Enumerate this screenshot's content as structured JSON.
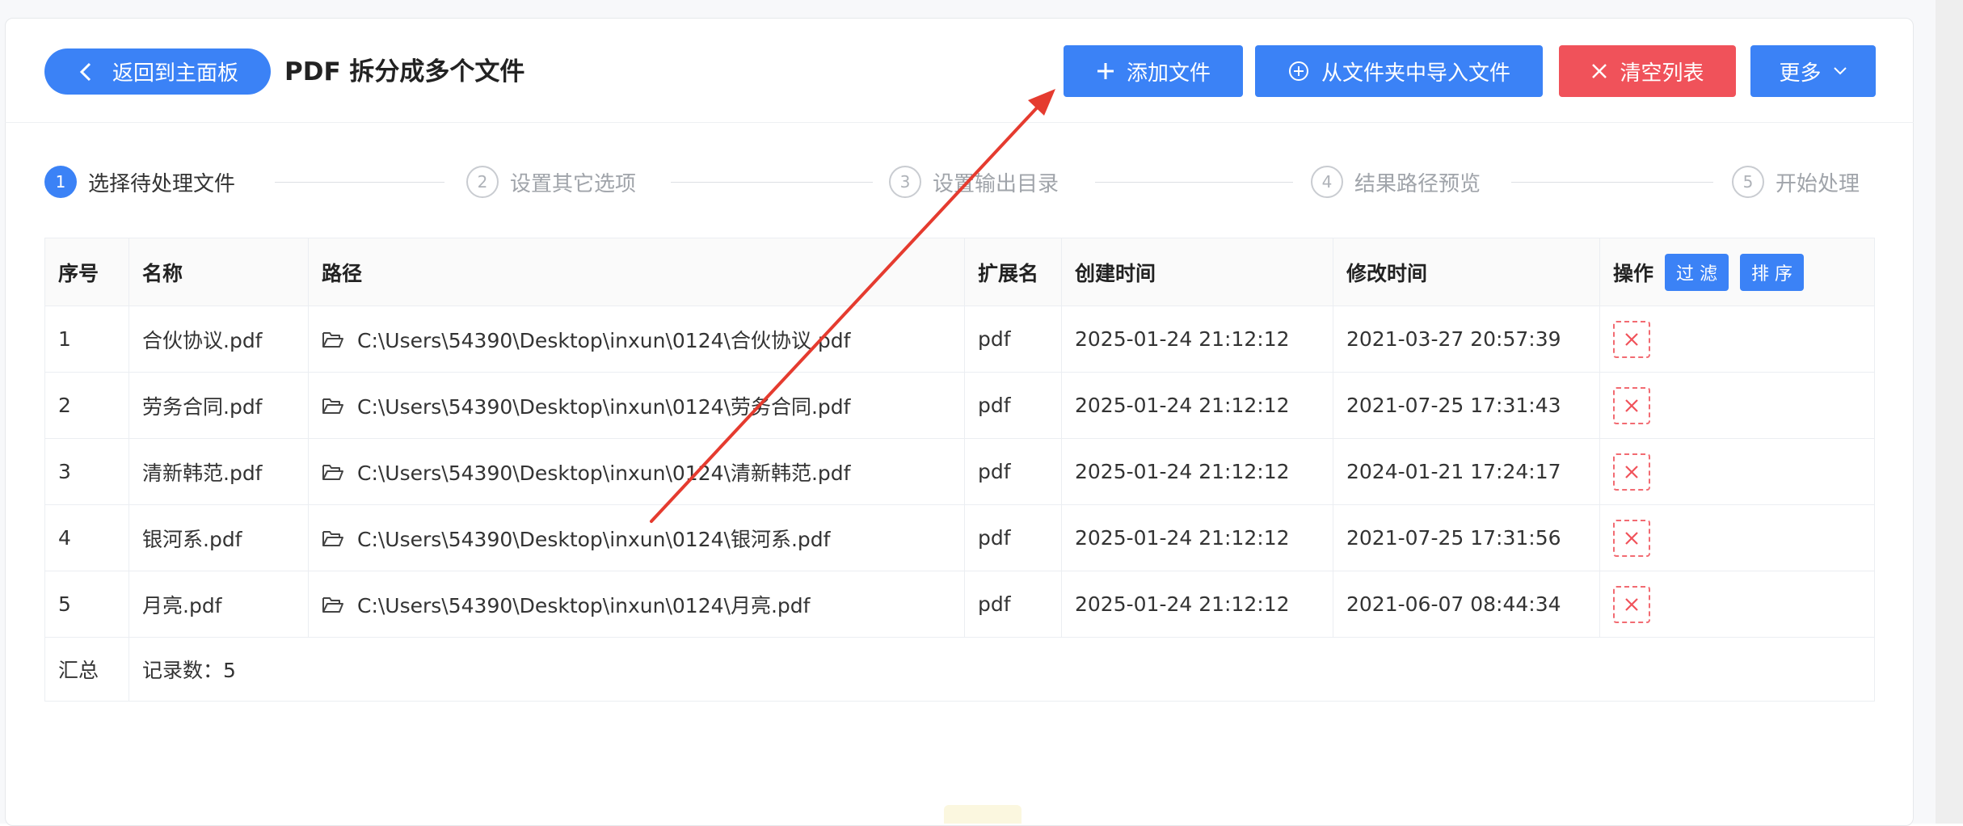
{
  "header": {
    "back_label": "返回到主面板",
    "title": "PDF 拆分成多个文件"
  },
  "toolbar": {
    "add_label": "添加文件",
    "import_label": "从文件夹中导入文件",
    "clear_label": "清空列表",
    "more_label": "更多"
  },
  "steps": [
    {
      "num": "1",
      "label": "选择待处理文件",
      "active": true
    },
    {
      "num": "2",
      "label": "设置其它选项",
      "active": false
    },
    {
      "num": "3",
      "label": "设置输出目录",
      "active": false
    },
    {
      "num": "4",
      "label": "结果路径预览",
      "active": false
    },
    {
      "num": "5",
      "label": "开始处理",
      "active": false
    }
  ],
  "table": {
    "columns": {
      "idx": "序号",
      "name": "名称",
      "path": "路径",
      "ext": "扩展名",
      "ctime": "创建时间",
      "mtime": "修改时间",
      "op": "操作"
    },
    "filter_label": "过 滤",
    "sort_label": "排 序",
    "rows": [
      {
        "idx": "1",
        "name": "合伙协议.pdf",
        "path": "C:\\Users\\54390\\Desktop\\inxun\\0124\\合伙协议.pdf",
        "ext": "pdf",
        "ctime": "2025-01-24 21:12:12",
        "mtime": "2021-03-27 20:57:39"
      },
      {
        "idx": "2",
        "name": "劳务合同.pdf",
        "path": "C:\\Users\\54390\\Desktop\\inxun\\0124\\劳务合同.pdf",
        "ext": "pdf",
        "ctime": "2025-01-24 21:12:12",
        "mtime": "2021-07-25 17:31:43"
      },
      {
        "idx": "3",
        "name": "清新韩范.pdf",
        "path": "C:\\Users\\54390\\Desktop\\inxun\\0124\\清新韩范.pdf",
        "ext": "pdf",
        "ctime": "2025-01-24 21:12:12",
        "mtime": "2024-01-21 17:24:17"
      },
      {
        "idx": "4",
        "name": "银河系.pdf",
        "path": "C:\\Users\\54390\\Desktop\\inxun\\0124\\银河系.pdf",
        "ext": "pdf",
        "ctime": "2025-01-24 21:12:12",
        "mtime": "2021-07-25 17:31:56"
      },
      {
        "idx": "5",
        "name": "月亮.pdf",
        "path": "C:\\Users\\54390\\Desktop\\inxun\\0124\\月亮.pdf",
        "ext": "pdf",
        "ctime": "2025-01-24 21:12:12",
        "mtime": "2021-06-07 08:44:34"
      }
    ],
    "summary_label": "汇总",
    "summary_value": "记录数：5"
  },
  "icons": {
    "back": "chevron-left-icon",
    "add": "plus-icon",
    "import": "circle-plus-icon",
    "clear": "close-icon",
    "more": "chevron-down-icon",
    "folder": "folder-open-icon",
    "delete": "delete-x-icon",
    "annotation": "red-arrow-annotation"
  },
  "colors": {
    "primary": "#3b82f6",
    "danger": "#f0525a",
    "annotation_arrow": "#e53b2f"
  }
}
